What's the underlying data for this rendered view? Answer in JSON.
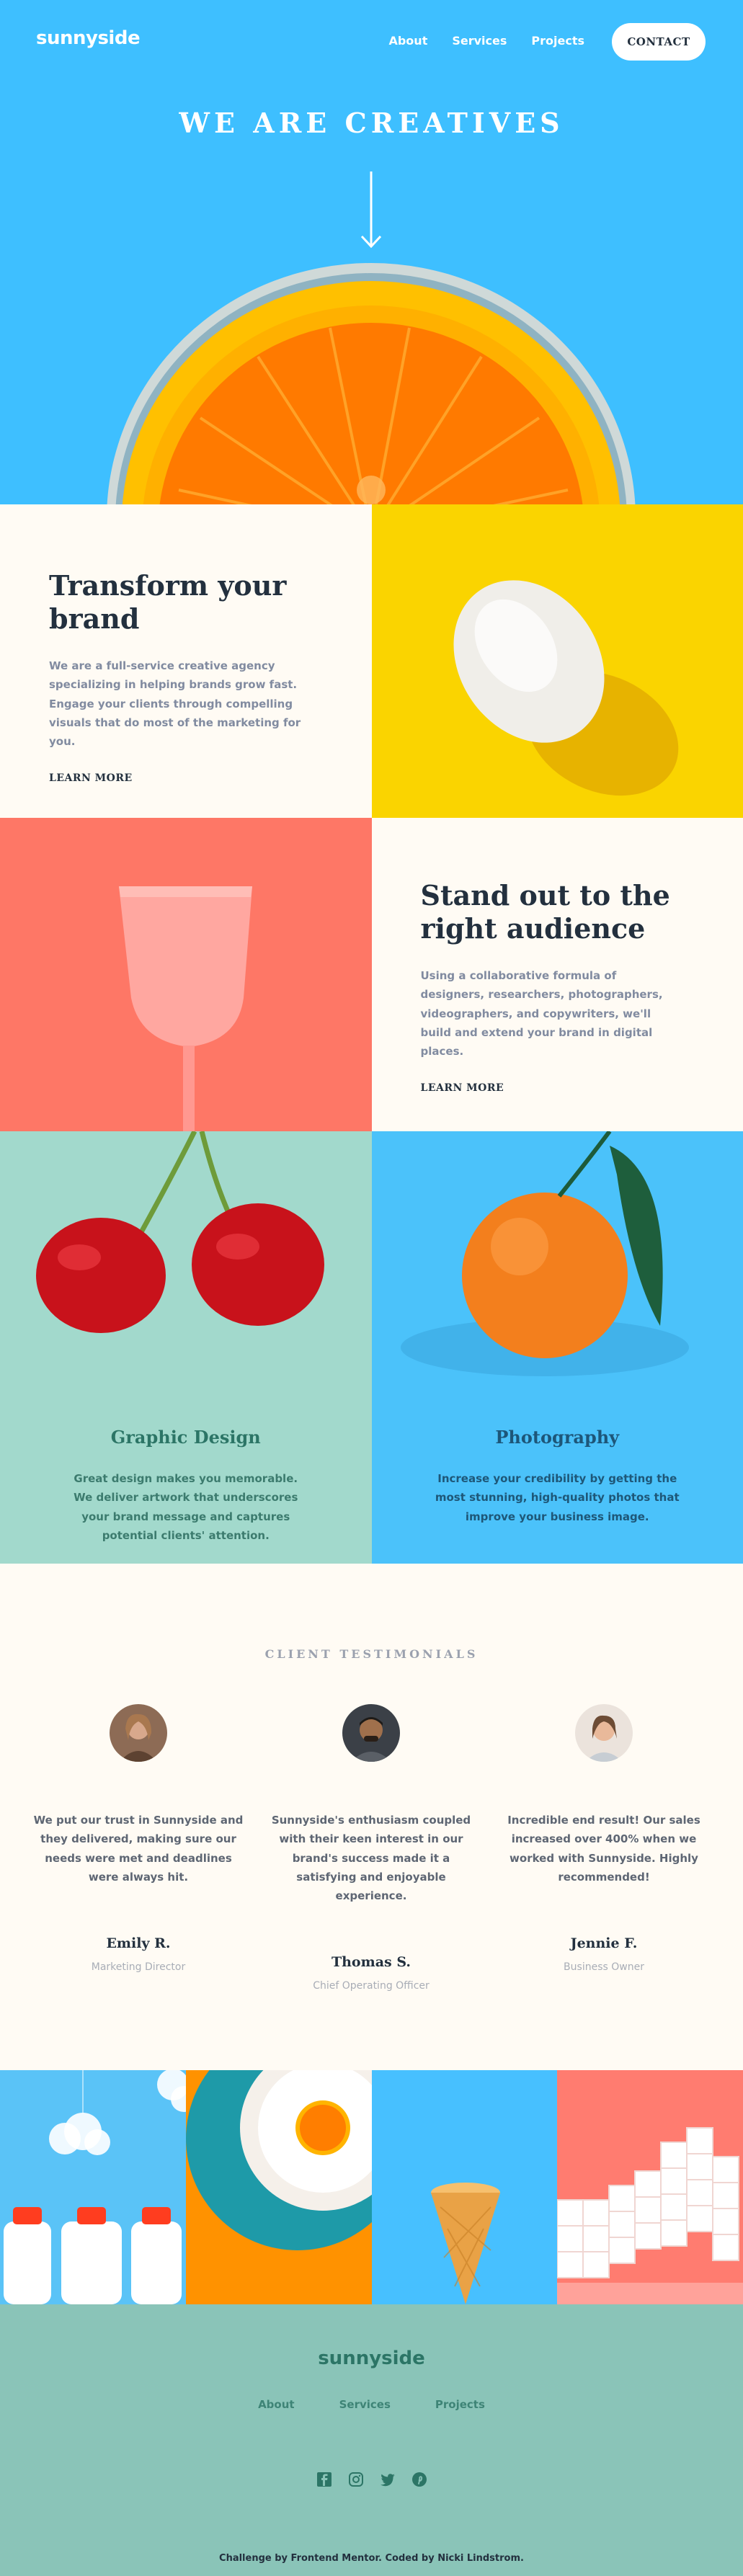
{
  "nav": {
    "logo": "sunnyside",
    "links": [
      "About",
      "Services",
      "Projects"
    ],
    "cta": "CONTACT"
  },
  "hero": {
    "title": "WE ARE CREATIVES"
  },
  "transform": {
    "title_line1": "Transform your",
    "title_line2": "brand",
    "body": "We are a full-service creative agency specializing in helping brands grow fast. Engage your clients through compelling visuals that do most of the marketing for you.",
    "link": "LEARN MORE"
  },
  "standout": {
    "title_line1": "Stand out to the",
    "title_line2": "right audience",
    "body": "Using a collaborative formula of designers, researchers, photographers, videographers, and copywriters, we'll build and extend your brand in digital places.",
    "link": "LEARN MORE"
  },
  "graphic": {
    "title": "Graphic Design",
    "body": "Great design makes you memorable. We deliver artwork that underscores your brand message and captures potential clients' attention."
  },
  "photography": {
    "title": "Photography",
    "body": "Increase your credibility by getting the most stunning, high-quality photos that improve your business image."
  },
  "testimonials": {
    "label": "CLIENT TESTIMONIALS",
    "items": [
      {
        "quote": "We put our trust in Sunnyside and they delivered, making sure our needs were met and deadlines were always hit.",
        "name": "Emily R.",
        "role": "Marketing Director"
      },
      {
        "quote": "Sunnyside's enthusiasm coupled with their keen interest in our brand's success made it a satisfying and enjoyable experience.",
        "name": "Thomas S.",
        "role": "Chief Operating Officer"
      },
      {
        "quote": "Incredible end result! Our sales increased over 400% when we worked with Sunnyside. Highly recommended!",
        "name": "Jennie F.",
        "role": "Business Owner"
      }
    ]
  },
  "footer": {
    "logo": "sunnyside",
    "links": [
      "About",
      "Services",
      "Projects"
    ],
    "social_icons": [
      "facebook-icon",
      "instagram-icon",
      "twitter-icon",
      "pinterest-icon"
    ],
    "credit": "Challenge by Frontend Mentor. Coded by Nicki Lindstrom."
  },
  "colors": {
    "hero_blue": "#3ebfff",
    "cream": "#fffbf4",
    "yellow": "#fad400",
    "red": "#fe7766",
    "mint": "#a2d9cc",
    "footer_green": "#8ac4b8",
    "dark": "#23303e"
  }
}
